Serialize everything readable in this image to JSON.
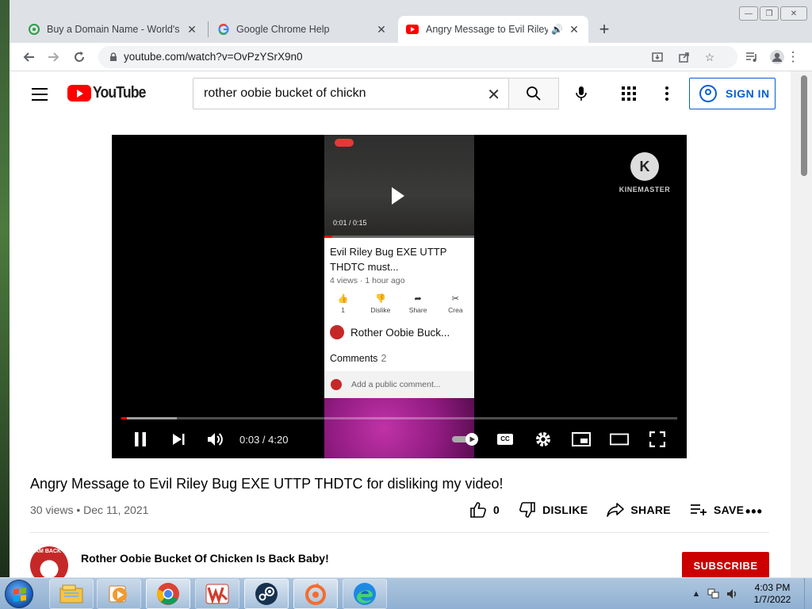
{
  "browser": {
    "tabs": [
      {
        "title": "Buy a Domain Name - World's Be",
        "favicon": "godaddy-icon",
        "active": false
      },
      {
        "title": "Google Chrome Help",
        "favicon": "google-icon",
        "active": false
      },
      {
        "title": "Angry Message to Evil Riley",
        "favicon": "youtube-icon",
        "active": true,
        "audio": true
      }
    ],
    "new_tab": "+",
    "url": "youtube.com/watch?v=OvPzYSrX9n0"
  },
  "youtube": {
    "logo_text": "YouTube",
    "search_query": "rother oobie bucket of chickn",
    "sign_in_label": "SIGN IN"
  },
  "player": {
    "time": "0:03 / 4:20",
    "progress_fraction": 0.01,
    "loaded_fraction": 0.1,
    "embedded_phone": {
      "time": "0:01 / 0:15",
      "title": "Evil Riley Bug EXE UTTP THDTC must...",
      "meta": "4 views · 1 hour ago",
      "actions": [
        {
          "label": "1",
          "icon": "thumb-up-icon"
        },
        {
          "label": "Dislike",
          "icon": "thumb-down-icon"
        },
        {
          "label": "Share",
          "icon": "share-icon"
        },
        {
          "label": "Crea",
          "icon": "create-icon"
        }
      ],
      "channel": "Rother Oobie Buck...",
      "comments_label": "Comments",
      "comments_count": "2",
      "add_comment": "Add a public comment..."
    },
    "watermark": {
      "letter": "K",
      "text": "KINEMASTER"
    }
  },
  "video": {
    "title": "Angry Message to Evil Riley Bug EXE UTTP THDTC for disliking my video!",
    "views": "30 views",
    "date": "Dec 11, 2021",
    "like_count": "0",
    "dislike_label": "DISLIKE",
    "share_label": "SHARE",
    "save_label": "SAVE",
    "channel_name": "Rother Oobie Bucket Of Chicken Is Back Baby!",
    "channel_avatar_text": "AM BACK",
    "subscribe_label": "SUBSCRIBE"
  },
  "taskbar": {
    "apps": [
      "explorer-icon",
      "media-player-icon",
      "chrome-icon",
      "wps-office-icon",
      "steam-icon",
      "origin-icon",
      "edge-icon"
    ],
    "time": "4:03 PM",
    "date": "1/7/2022"
  },
  "colors": {
    "youtube_red": "#ff0000",
    "link_blue": "#065fd4",
    "subscribe_red": "#cc0000"
  }
}
